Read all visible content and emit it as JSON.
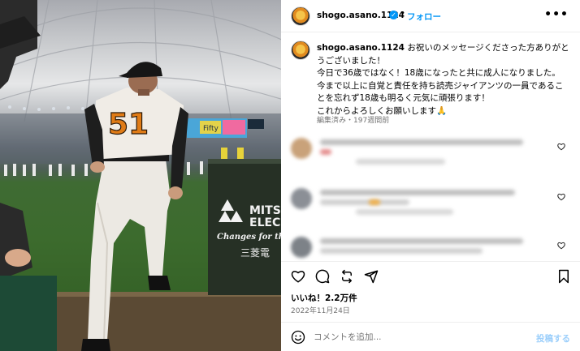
{
  "photo": {
    "jersey_number": "51",
    "banner_text": "Fifty",
    "sign_lines": [
      "MITS",
      "ELEC",
      "Changes for th",
      "三菱電"
    ]
  },
  "header": {
    "username": "shogo.asano.1124",
    "verified_icon": "✓",
    "separator": "•",
    "follow_label": "フォロー",
    "more_label": "•••"
  },
  "caption": {
    "username": "shogo.asano.1124",
    "text": "お祝いのメッセージくださった方ありがとうございました！\n今日で36歳ではなく！18歳になったと共に成人になりました。\n今まで以上に自覚と責任を持ち読売ジャイアンツの一員であることを忘れず18歳も明るく元気に頑張ります！\nこれからよろしくお願いします🙏",
    "edited_label": "編集済み",
    "separator": "・",
    "age": "197週間前"
  },
  "comments_blurred": 3,
  "engagement": {
    "likes_label": "いいね！2.2万件",
    "date": "2022年11月24日"
  },
  "comment_box": {
    "placeholder": "コメントを追加...",
    "post_label": "投稿する"
  },
  "colors": {
    "accent": "#0095f6",
    "post_disabled": "#9ccffb",
    "muted_text": "#737373"
  }
}
